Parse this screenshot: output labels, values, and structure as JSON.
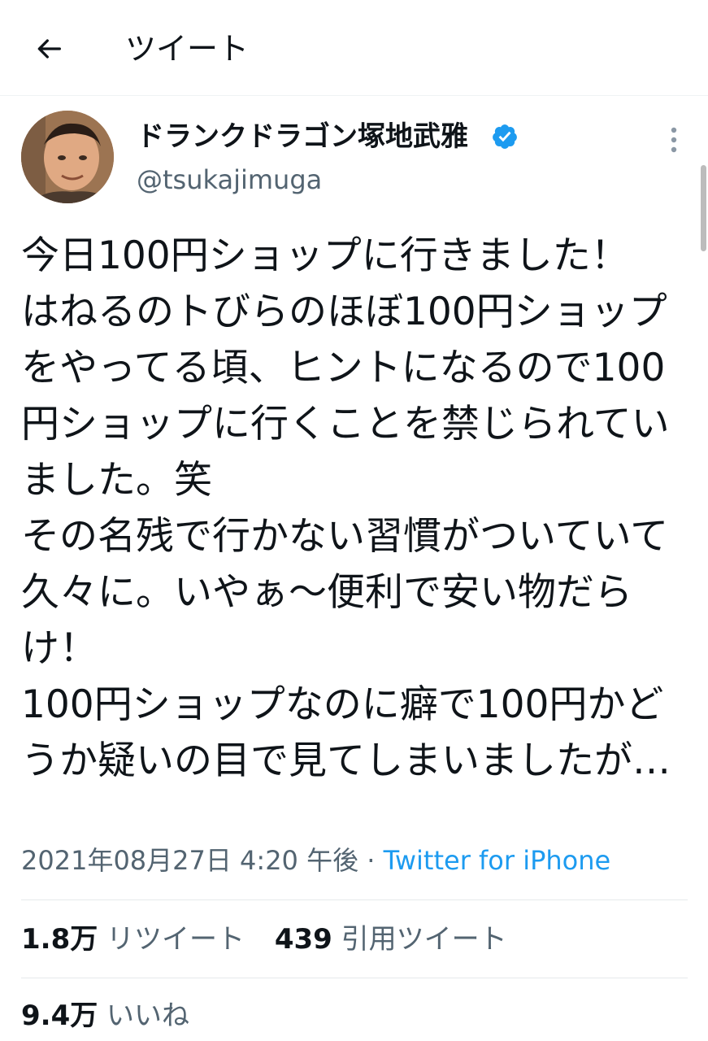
{
  "header": {
    "title": "ツイート",
    "back_icon": "arrow-left-icon"
  },
  "author": {
    "display_name": "ドランクドラゴン塚地武雅",
    "handle": "@tsukajimuga",
    "verified": true,
    "verified_color": "#1d9bf0"
  },
  "tweet": {
    "text": "今日100円ショップに行きました！\nはねるのトびらのほぼ100円ショップをやってる頃、ヒントになるので100円ショップに行くことを禁じられていました。笑\nその名残で行かない習慣がついていて久々に。いやぁ〜便利で安い物だらけ！\n100円ショップなのに癖で100円かどうか疑いの目で見てしまいましたが…",
    "timestamp": "2021年08月27日 4:20 午後",
    "separator": " · ",
    "source": "Twitter for iPhone"
  },
  "stats": {
    "retweets_count": "1.8万",
    "retweets_label": "リツイート",
    "quotes_count": "439",
    "quotes_label": "引用ツイート",
    "likes_count": "9.4万",
    "likes_label": "いいね"
  },
  "colors": {
    "text_primary": "#0f1419",
    "text_secondary": "#536471",
    "accent": "#1d9bf0"
  }
}
